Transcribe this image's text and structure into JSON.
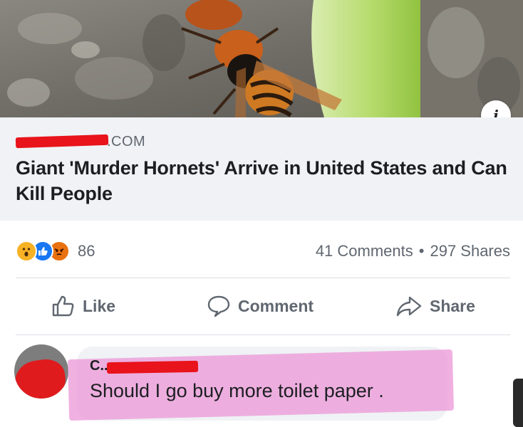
{
  "link_preview": {
    "image_icon": "hornet-photo",
    "info_icon": "info-icon",
    "info_label": "i",
    "domain_suffix": ".COM",
    "title": "Giant 'Murder Hornets' Arrive in United States and Can Kill People"
  },
  "engagement": {
    "reactions": [
      "wow",
      "like",
      "angry"
    ],
    "reaction_count": "86",
    "comments": "41 Comments",
    "separator": "•",
    "shares": "297 Shares"
  },
  "actions": {
    "like_label": "Like",
    "comment_label": "Comment",
    "share_label": "Share"
  },
  "comment": {
    "commenter_initial": "C...",
    "text": "Should I go buy more toilet paper ."
  },
  "colors": {
    "redaction": "#e8131b",
    "highlight": "#ec9bd8",
    "meta_background": "#f0f2f5",
    "secondary_text": "#606770",
    "primary_text": "#1c1e21",
    "like_blue": "#1877f2"
  }
}
